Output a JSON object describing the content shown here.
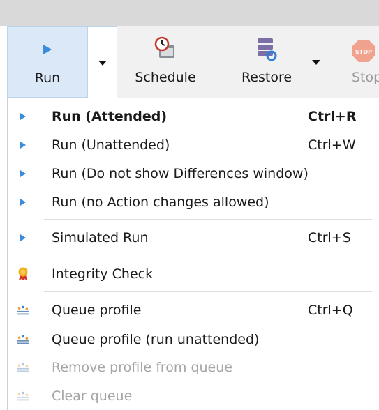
{
  "toolbar": {
    "run_label": "Run",
    "schedule_label": "Schedule",
    "restore_label": "Restore",
    "stop_label": "Stop",
    "stop_icon_text": "STOP"
  },
  "menu": {
    "items": [
      {
        "label": "Run (Attended)",
        "shortcut": "Ctrl+R",
        "icon": "play-icon"
      },
      {
        "label": "Run (Unattended)",
        "shortcut": "Ctrl+W",
        "icon": "play-icon"
      },
      {
        "label": "Run (Do not show Differences window)",
        "shortcut": "",
        "icon": "play-icon"
      },
      {
        "label": "Run (no Action changes allowed)",
        "shortcut": "",
        "icon": "play-icon"
      },
      {
        "label": "Simulated Run",
        "shortcut": "Ctrl+S",
        "icon": "play-icon"
      },
      {
        "label": "Integrity Check",
        "shortcut": "",
        "icon": "medal-icon"
      },
      {
        "label": "Queue profile",
        "shortcut": "Ctrl+Q",
        "icon": "queue-icon"
      },
      {
        "label": "Queue profile (run unattended)",
        "shortcut": "",
        "icon": "queue-icon"
      },
      {
        "label": "Remove profile from queue",
        "shortcut": "",
        "icon": "queue-icon"
      },
      {
        "label": "Clear queue",
        "shortcut": "",
        "icon": "queue-icon"
      }
    ]
  },
  "colors": {
    "accent": "#3b8edb",
    "disabled_text": "#a5a5a5",
    "run_highlight": "#dbe8f7"
  }
}
